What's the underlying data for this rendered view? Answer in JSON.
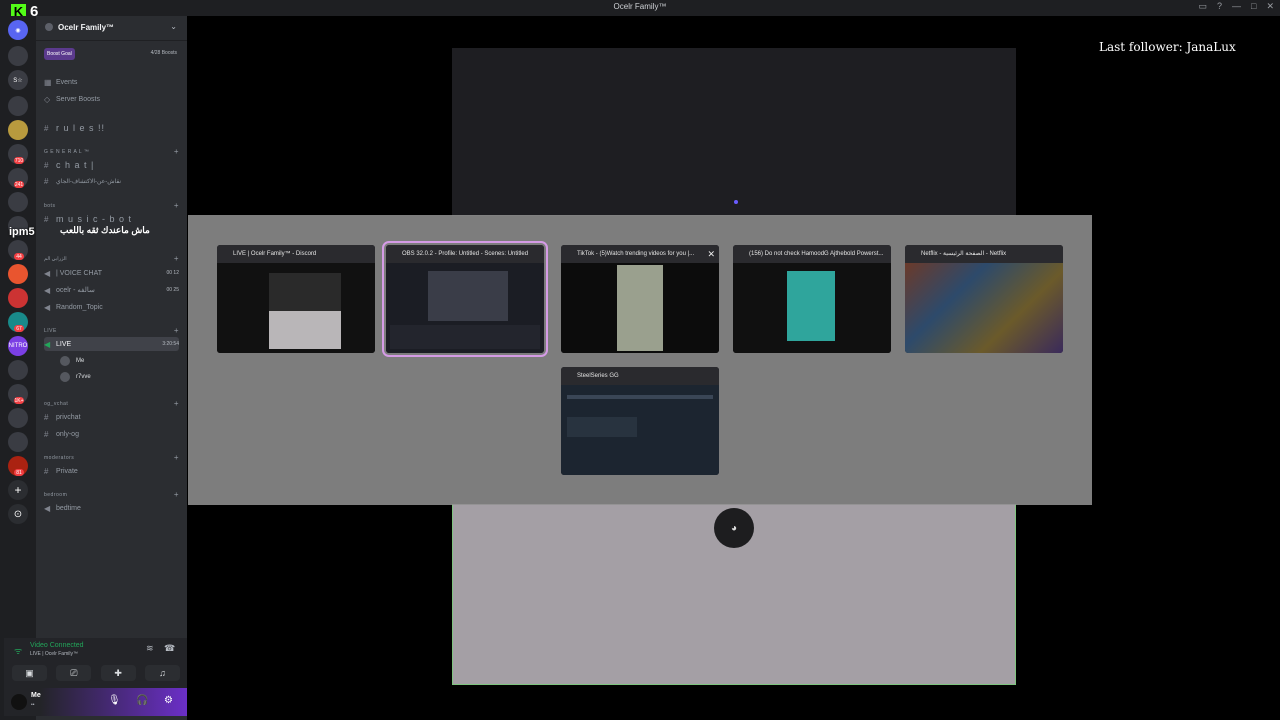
{
  "app": {
    "window_title": "Ocelr Family™",
    "kick_count": "6"
  },
  "rail": {
    "badges": [
      "710",
      "241",
      "44",
      "67",
      "1K+",
      "81"
    ]
  },
  "server": {
    "name": "Ocelr Family™",
    "boost_goal": "Boost Goal",
    "boost_count": "4/28 Boosts",
    "top_items": [
      "Events",
      "Server Boosts"
    ],
    "rules": "r u l e s !!"
  },
  "categories": {
    "general": "G E N E R A L ™",
    "bots": "bots",
    "voice": "الزرابي الم",
    "live": "LIVE",
    "og": "og_vchat",
    "mods": "moderators",
    "bedroom": "bedroom"
  },
  "channels": {
    "chat": "c h a t |",
    "arabic_text": "نقاش-عن-الاكتشاف-الجاي",
    "music_bot": "m u s i c - b o t",
    "voice_chat": "| VOICE CHAT",
    "voice_chat_count": "00 12",
    "ocelr": "ocelr - سالفه",
    "ocelr_count": "00 25",
    "random": "Random_Topic",
    "live": "LIVE",
    "live_timer": "3:20:54",
    "privchat": "privchat",
    "only_og": "only-og",
    "private": "Private",
    "bedtime": "bedtime"
  },
  "live_users": [
    "Me",
    "r7vve"
  ],
  "overlay_text": {
    "ipm": "ipm5",
    "arabic": "ماش ماعندك ثقه باللعب"
  },
  "voice_panel": {
    "status": "Video Connected",
    "channel": "LIVE | Ocelr Family™"
  },
  "user": {
    "name": "Me",
    "status": "••"
  },
  "stream": {
    "last_follower": "Last follower: JanaLux"
  },
  "switcher": {
    "windows": [
      {
        "title": "LIVE | Ocelr Family™ - Discord",
        "color": "#5865f2"
      },
      {
        "title": "OBS 32.0.2 - Profile: Untitled - Scenes: Untitled",
        "color": "#d0d0d0"
      },
      {
        "title": "TikTok - (5)Watch trending videos for you |...",
        "color": "#ffffff"
      },
      {
        "title": "(156) Do not check HamoodG Ajthebold Powerst...",
        "color": "#ff3b30"
      },
      {
        "title": "Netflix - الصفحة الرئيسية - Netflix",
        "color": "#e50914"
      },
      {
        "title": "SteelSeries GG",
        "color": "#ff7a00"
      }
    ]
  }
}
